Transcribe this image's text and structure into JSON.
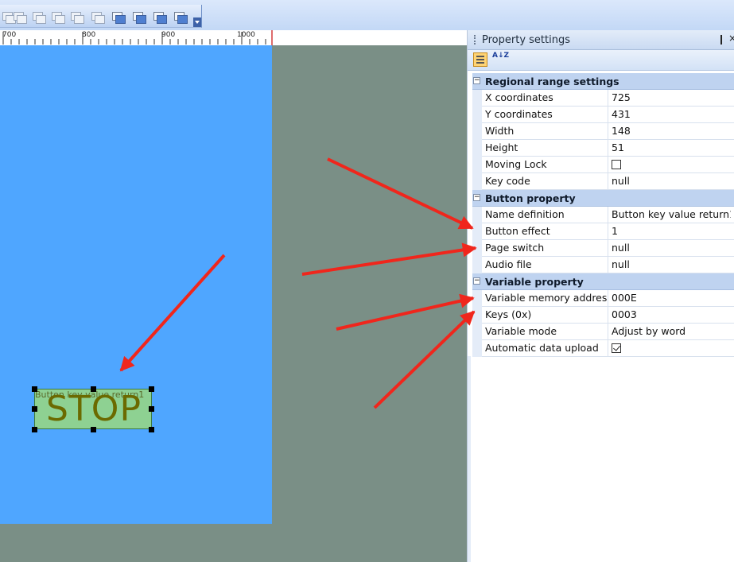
{
  "toolbar": {
    "buttons": [
      "align-left-icon",
      "distribute-h-icon",
      "align-top-icon",
      "align-middle-icon",
      "distribute-v-icon",
      "group-icon",
      "bring-front-icon",
      "send-back-icon",
      "bring-forward-icon",
      "send-backward-icon"
    ]
  },
  "ruler": {
    "labels": [
      "700",
      "800",
      "900",
      "1000"
    ]
  },
  "canvas": {
    "stop_button": {
      "name_label": "Button key value return1",
      "text": "STOP"
    }
  },
  "panel": {
    "title": "Property settings",
    "pin_glyph": "❙",
    "close_glyph": "×",
    "alpha_sort_label": "A↓Z",
    "categories": [
      {
        "label": "Regional range settings",
        "expander": "−",
        "rows": [
          {
            "name": "X coordinates",
            "value": "725"
          },
          {
            "name": "Y coordinates",
            "value": "431"
          },
          {
            "name": "Width",
            "value": "148"
          },
          {
            "name": "Height",
            "value": "51"
          },
          {
            "name": "Moving Lock",
            "value": "",
            "checkbox": false
          },
          {
            "name": "Key code",
            "value": "null"
          }
        ]
      },
      {
        "label": "Button property",
        "expander": "−",
        "rows": [
          {
            "name": "Name definition",
            "value": "Button key value return1"
          },
          {
            "name": "Button effect",
            "value": "1"
          },
          {
            "name": "Page switch",
            "value": "null"
          },
          {
            "name": "Audio file",
            "value": "null"
          }
        ]
      },
      {
        "label": "Variable property",
        "expander": "−",
        "rows": [
          {
            "name": "Variable memory address",
            "value": "000E"
          },
          {
            "name": "Keys (0x)",
            "value": "0003"
          },
          {
            "name": "Variable mode",
            "value": "Adjust by word"
          },
          {
            "name": "Automatic data upload",
            "value": "",
            "checkbox": true
          }
        ]
      }
    ]
  },
  "colors": {
    "annotation_arrow": "#f0261c",
    "design_screen": "#4fa6ff",
    "workspace": "#7a8f86"
  }
}
